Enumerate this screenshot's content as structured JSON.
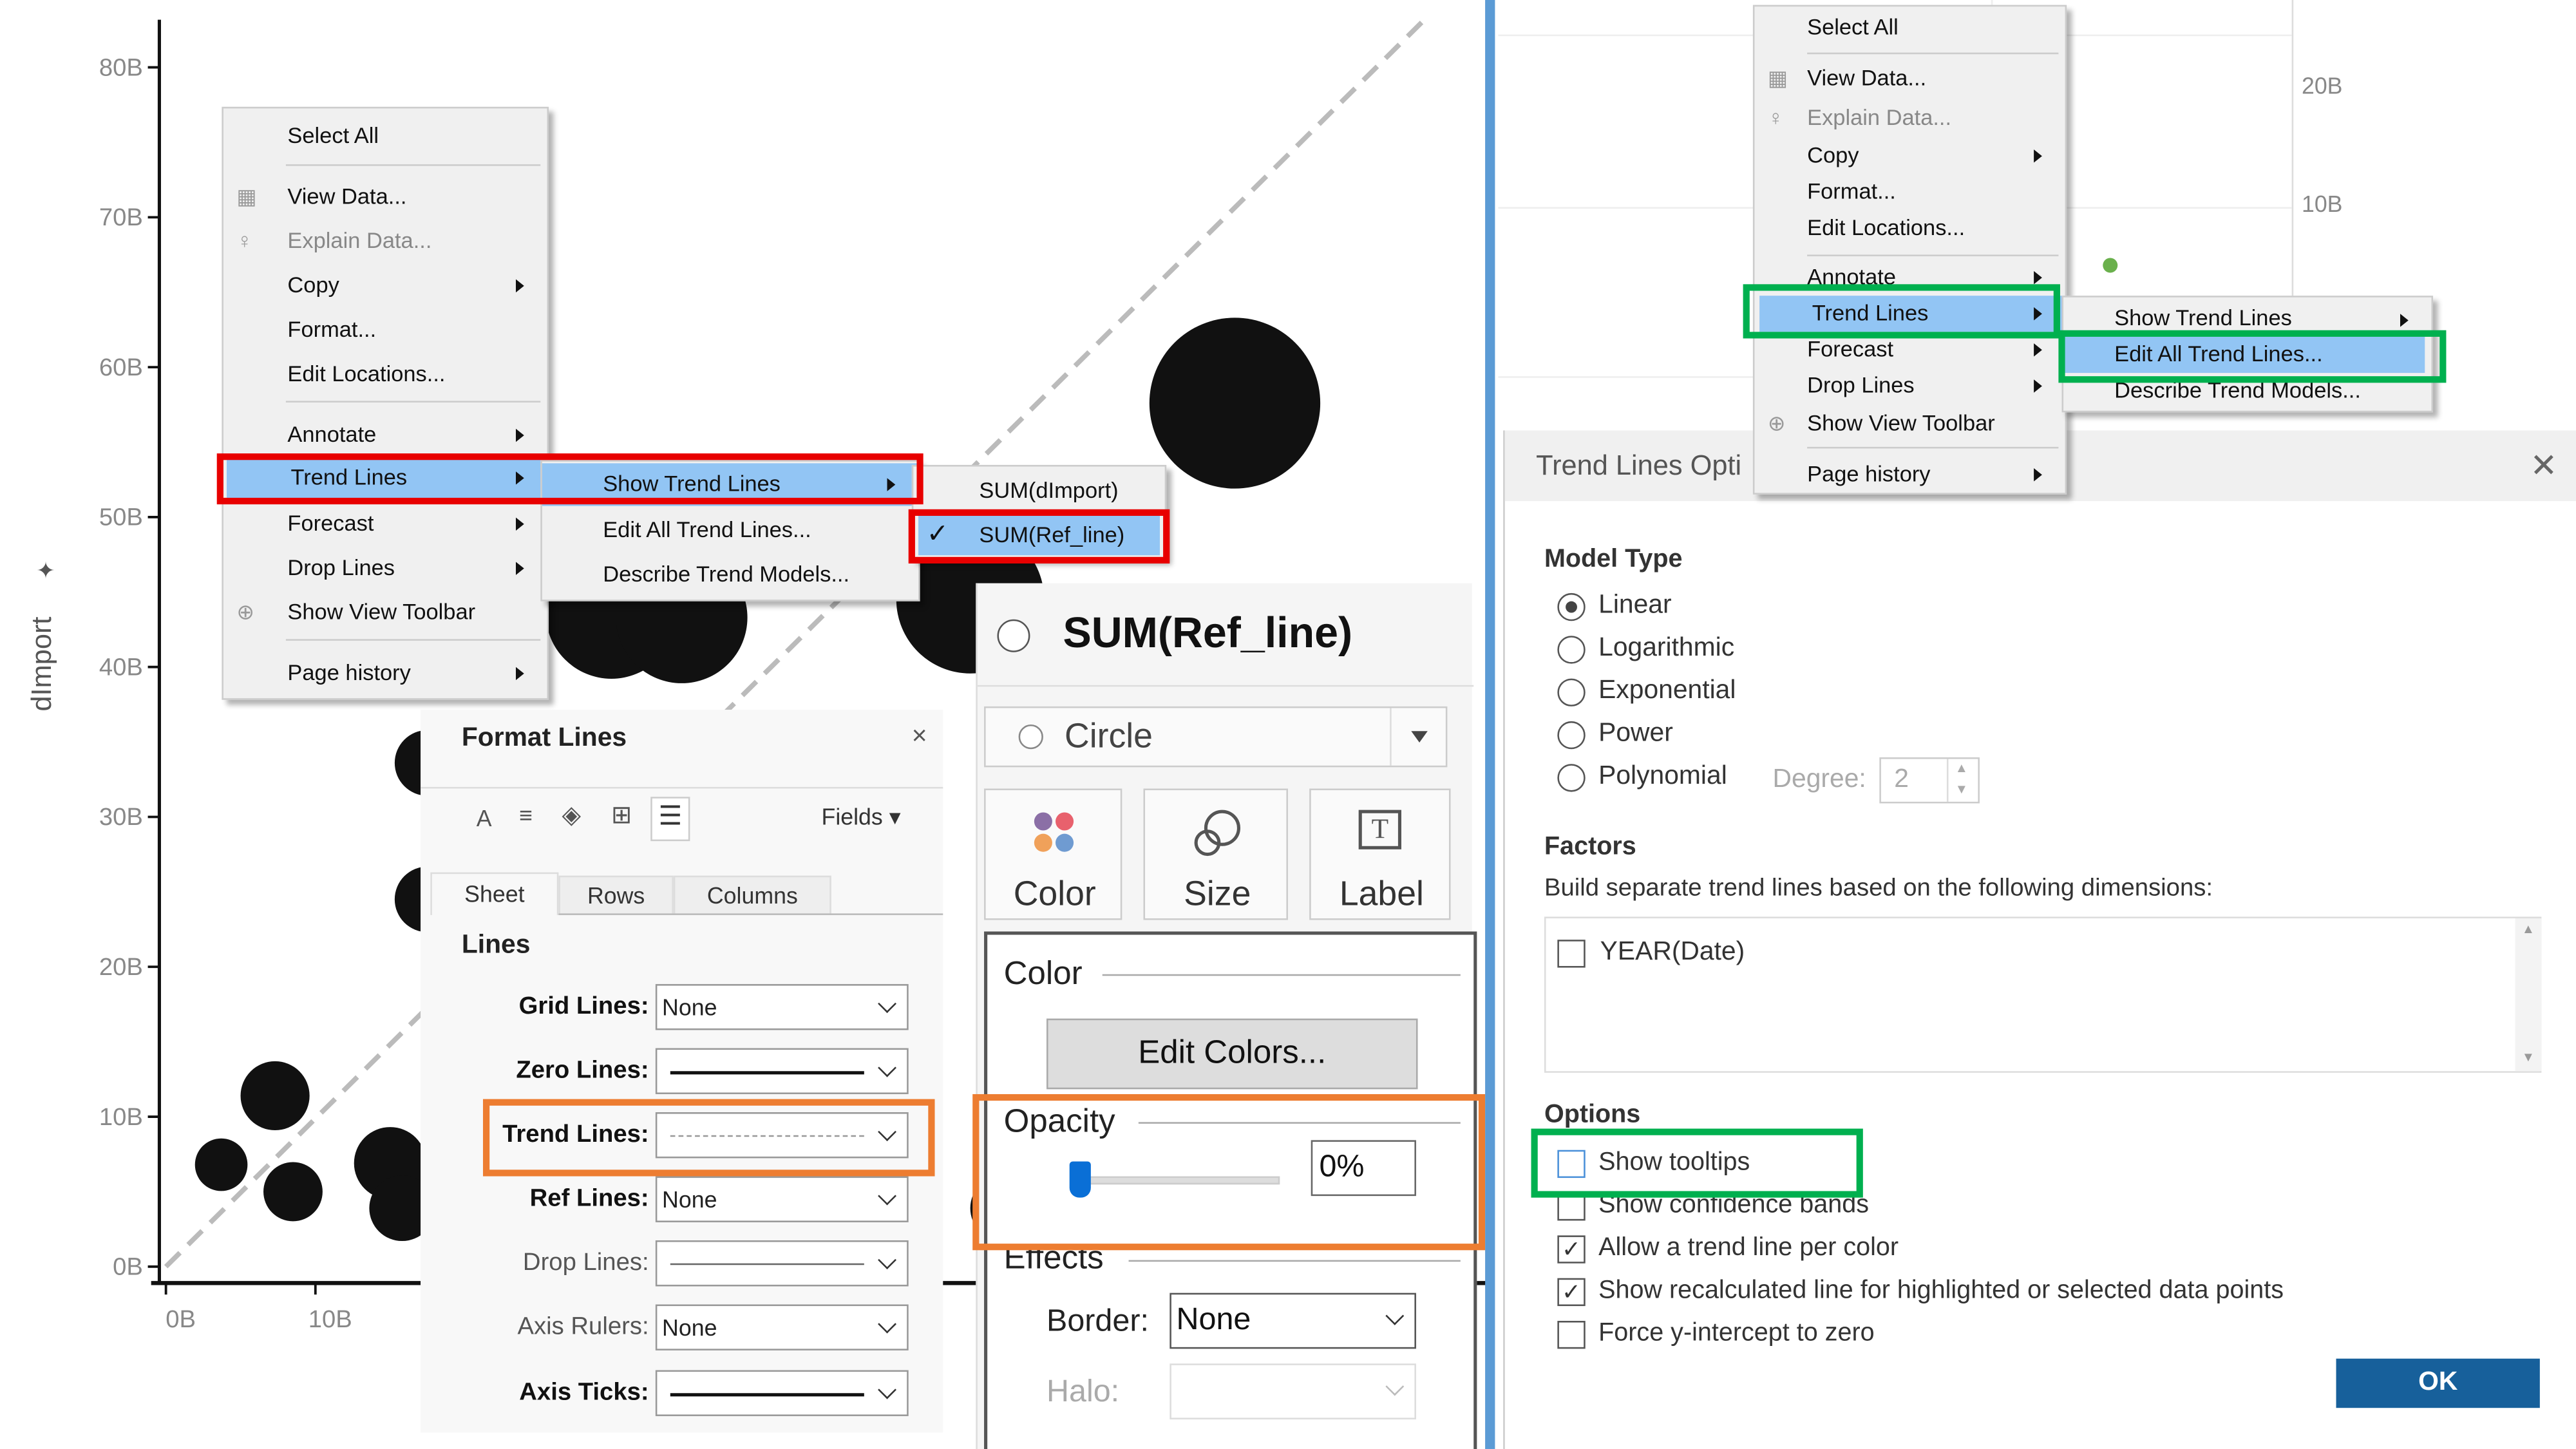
{
  "chart_data": {
    "type": "scatter",
    "ylabel": "dImport",
    "xlabel": "",
    "y_ticks": [
      "0B",
      "10B",
      "20B",
      "30B",
      "40B",
      "50B",
      "60B",
      "70B",
      "80B"
    ],
    "x_ticks": [
      "0B",
      "10B"
    ],
    "ylim": [
      0,
      82
    ],
    "xlim": [
      0,
      88
    ],
    "mark_color": "#111111",
    "reference_line": {
      "style": "dashed",
      "color": "#bbbbbb",
      "from": [
        0,
        0
      ],
      "to": [
        84,
        83
      ]
    },
    "points": [
      {
        "x": 3.7,
        "y": 6.8,
        "size": 16
      },
      {
        "x": 7.3,
        "y": 11.4,
        "size": 21
      },
      {
        "x": 8.5,
        "y": 5.0,
        "size": 18
      },
      {
        "x": 15.0,
        "y": 6.9,
        "size": 22
      },
      {
        "x": 15.8,
        "y": 3.9,
        "size": 20
      },
      {
        "x": 17.5,
        "y": 33.6,
        "size": 20
      },
      {
        "x": 17.5,
        "y": 24.5,
        "size": 20
      },
      {
        "x": 29.8,
        "y": 43.6,
        "size": 40
      },
      {
        "x": 34.5,
        "y": 43.3,
        "size": 40
      },
      {
        "x": 53.8,
        "y": 44.5,
        "size": 45
      },
      {
        "x": 71.5,
        "y": 57.6,
        "size": 52
      },
      {
        "x": 56.0,
        "y": 3.9,
        "size": 20
      }
    ]
  },
  "left_menu": {
    "items": [
      {
        "label": "Select All"
      },
      {
        "label": "View Data...",
        "icon": "table-icon"
      },
      {
        "label": "Explain Data...",
        "icon": "lightbulb-icon",
        "disabled": true
      },
      {
        "label": "Copy",
        "submenu": true
      },
      {
        "label": "Format..."
      },
      {
        "label": "Edit Locations..."
      },
      {
        "label": "Annotate",
        "submenu": true
      },
      {
        "label": "Trend Lines",
        "submenu": true,
        "highlighted": true
      },
      {
        "label": "Forecast",
        "submenu": true
      },
      {
        "label": "Drop Lines",
        "submenu": true
      },
      {
        "label": "Show View Toolbar",
        "icon": "zoom-in-icon"
      },
      {
        "label": "Page history",
        "submenu": true
      }
    ],
    "trend_submenu": [
      "Show Trend Lines",
      "Edit All Trend Lines...",
      "Describe Trend Models..."
    ],
    "show_submenu": [
      {
        "label": "SUM(dImport)",
        "checked": false
      },
      {
        "label": "SUM(Ref_line)",
        "checked": true
      }
    ]
  },
  "format_lines": {
    "title": "Format Lines",
    "fields_label": "Fields",
    "tabs": [
      "Sheet",
      "Rows",
      "Columns"
    ],
    "active_tab": "Sheet",
    "section": "Lines",
    "rows": [
      {
        "label": "Grid Lines:",
        "value": "None"
      },
      {
        "label": "Zero Lines:",
        "value": "solid"
      },
      {
        "label": "Trend Lines:",
        "value": "dashed"
      },
      {
        "label": "Ref Lines:",
        "value": "None"
      },
      {
        "label": "Drop Lines:",
        "value": "thin"
      },
      {
        "label": "Axis Rulers:",
        "value": "None"
      },
      {
        "label": "Axis Ticks:",
        "value": "solid"
      }
    ]
  },
  "marks_card": {
    "title": "SUM(Ref_line)",
    "mark_type": "Circle",
    "buttons": [
      "Color",
      "Size",
      "Label"
    ],
    "color_section": "Color",
    "edit_colors": "Edit Colors...",
    "opacity_section": "Opacity",
    "opacity_value": "0%",
    "opacity_fraction": 0,
    "effects_section": "Effects",
    "border_label": "Border:",
    "border_value": "None",
    "halo_label": "Halo:"
  },
  "right_chart": {
    "y_ticks": [
      "20B",
      "10B"
    ],
    "point_color": "#6ab04c"
  },
  "right_menu": {
    "items": [
      {
        "label": "Select All"
      },
      {
        "label": "View Data..."
      },
      {
        "label": "Explain Data..."
      },
      {
        "label": "Copy"
      },
      {
        "label": "Format..."
      },
      {
        "label": "Edit Locations..."
      },
      {
        "label": "Annotate"
      },
      {
        "label": "Trend Lines"
      },
      {
        "label": "Forecast"
      },
      {
        "label": "Drop Lines"
      },
      {
        "label": "Show View Toolbar"
      },
      {
        "label": "Page history"
      }
    ],
    "trend_submenu": [
      "Show Trend Lines",
      "Edit All Trend Lines...",
      "Describe Trend Models..."
    ]
  },
  "dialog": {
    "title": "Trend Lines Opti",
    "model_type": "Model Type",
    "models": [
      "Linear",
      "Logarithmic",
      "Exponential",
      "Power",
      "Polynomial"
    ],
    "selected_model": "Linear",
    "degree_label": "Degree:",
    "degree_value": "2",
    "factors": "Factors",
    "factors_desc": "Build separate trend lines based on the following dimensions:",
    "factor_items": [
      {
        "label": "YEAR(Date)",
        "checked": false
      }
    ],
    "options": "Options",
    "option_items": [
      {
        "label": "Show tooltips",
        "checked": false
      },
      {
        "label": "Show confidence bands",
        "checked": false
      },
      {
        "label": "Allow a trend line per color",
        "checked": true
      },
      {
        "label": "Show recalculated line for highlighted or selected data points",
        "checked": true
      },
      {
        "label": "Force y-intercept to zero",
        "checked": false
      }
    ],
    "ok": "OK"
  }
}
